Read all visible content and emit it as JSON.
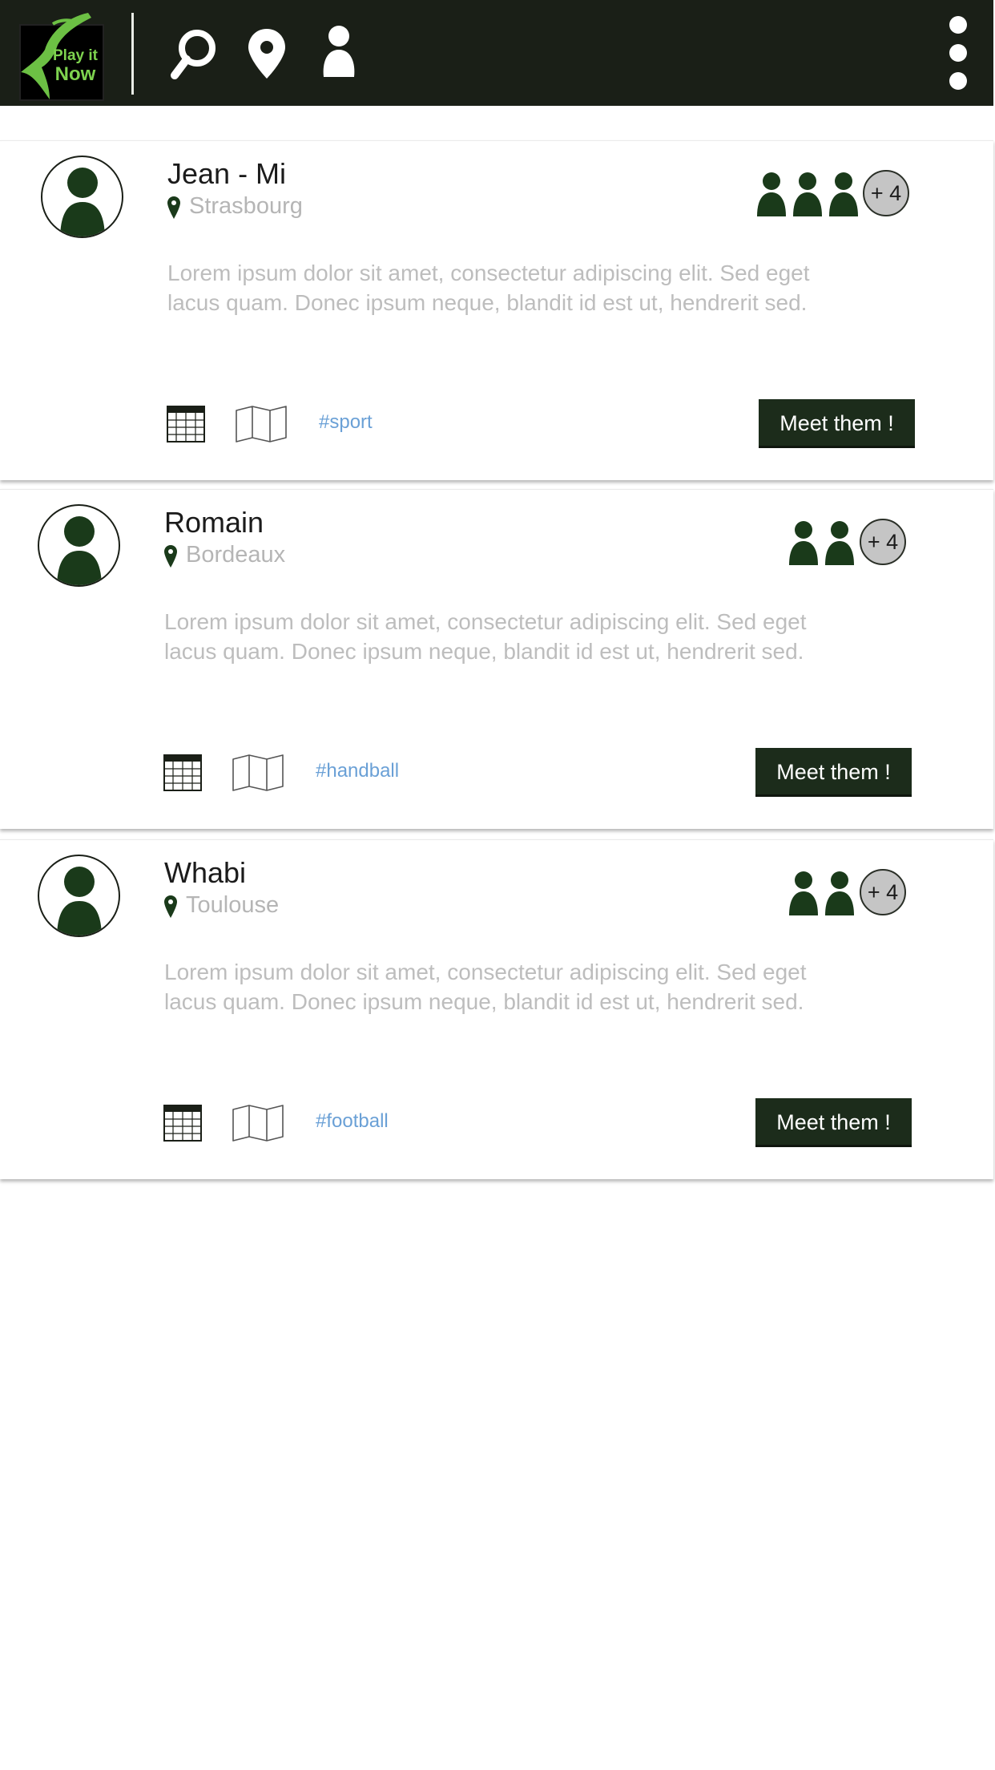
{
  "header": {
    "logo": {
      "line1": "Play it",
      "line2": "Now"
    },
    "icons": [
      "search-icon",
      "location-pin-icon",
      "profile-icon",
      "more-vertical-icon"
    ],
    "bar_color": "#1a1f17",
    "accent_color": "#7ed34f"
  },
  "cards": [
    {
      "name": "Jean - Mi",
      "city": "Strasbourg",
      "members_shown": 3,
      "extra_members": "+ 4",
      "description": "Lorem ipsum dolor sit amet, consectetur adipiscing elit. Sed eget lacus quam. Donec ipsum neque, blandit id est ut, hendrerit sed.",
      "tag": "#sport",
      "button": "Meet them !"
    },
    {
      "name": "Romain",
      "city": "Bordeaux",
      "members_shown": 2,
      "extra_members": "+ 4",
      "description": "Lorem ipsum dolor sit amet, consectetur adipiscing elit. Sed eget lacus quam. Donec ipsum neque, blandit id est ut, hendrerit sed.",
      "tag": "#handball",
      "button": "Meet them !"
    },
    {
      "name": "Whabi",
      "city": "Toulouse",
      "members_shown": 2,
      "extra_members": "+ 4",
      "description": "Lorem ipsum dolor sit amet, consectetur adipiscing elit. Sed eget lacus quam. Donec ipsum neque, blandit id est ut, hendrerit sed.",
      "tag": "#football",
      "button": "Meet them !"
    }
  ],
  "colors": {
    "button": "#1c2c1b",
    "tag": "#6aa0d6",
    "muted_text": "#b5b5b5"
  }
}
